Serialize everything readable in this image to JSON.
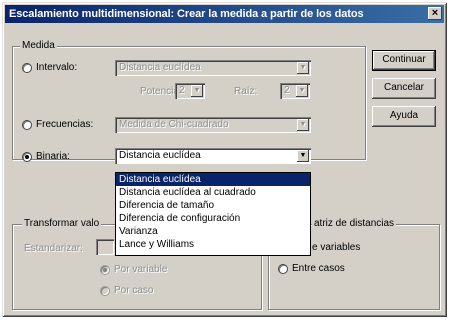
{
  "window": {
    "title": "Escalamiento multidimensional: Crear la medida a partir de los datos",
    "close_glyph": "×"
  },
  "medida": {
    "group_label": "Medida",
    "intervalo": {
      "label": "Intervalo:",
      "value": "Distancia euclídea",
      "selected": false,
      "potencia_label": "Potencia:",
      "potencia_value": "2",
      "raiz_label": "Raíz:",
      "raiz_value": "2"
    },
    "frecuencias": {
      "label": "Frecuencias:",
      "value": "Medida de Chi-cuadrado",
      "selected": false
    },
    "binaria": {
      "label": "Binaria:",
      "value": "Distancia euclídea",
      "selected": true
    }
  },
  "dropdown": {
    "options": [
      "Distancia euclídea",
      "Distancia euclídea al cuadrado",
      "Diferencia de tamaño",
      "Diferencia de configuración",
      "Varianza",
      "Lance y Williams"
    ],
    "selected_index": 0
  },
  "transformar": {
    "group_label": "Transformar valo",
    "estandarizar_label": "Estandarizar:",
    "por_variable": "Por variable",
    "por_caso": "Por caso"
  },
  "matriz": {
    "group_label": "atriz de distancias",
    "entre_variables": "e variables",
    "entre_casos": "Entre casos"
  },
  "buttons": {
    "continuar": "Continuar",
    "cancelar": "Cancelar",
    "ayuda": "Ayuda"
  },
  "colors": {
    "title_start": "#0a246a",
    "title_end": "#3a6ea5",
    "face": "#d4d0c8",
    "highlight": "#0a246a"
  }
}
